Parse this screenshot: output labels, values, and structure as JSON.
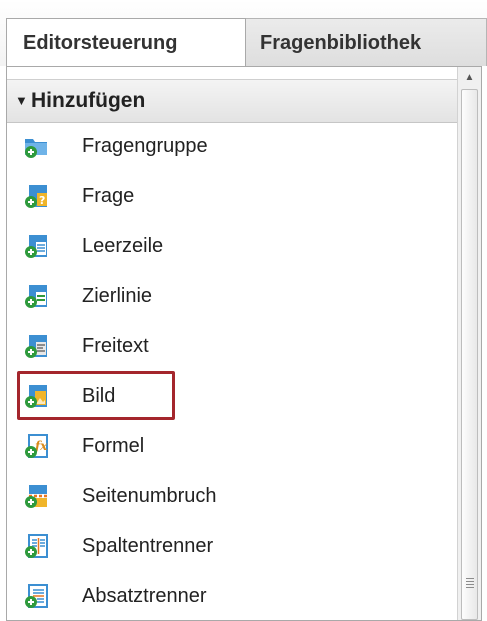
{
  "tabs": [
    {
      "label": "Editorsteuerung",
      "active": true
    },
    {
      "label": "Fragenbibliothek",
      "active": false
    }
  ],
  "section": {
    "title": "Hinzufügen",
    "expanded": true,
    "caret_icon": "caret-down-icon"
  },
  "items": [
    {
      "label": "Fragengruppe",
      "icon": "folder-add-icon"
    },
    {
      "label": "Frage",
      "icon": "question-add-icon"
    },
    {
      "label": "Leerzeile",
      "icon": "blank-line-add-icon"
    },
    {
      "label": "Zierlinie",
      "icon": "decorative-line-add-icon"
    },
    {
      "label": "Freitext",
      "icon": "free-text-add-icon"
    },
    {
      "label": "Bild",
      "icon": "image-add-icon",
      "highlighted": true
    },
    {
      "label": "Formel",
      "icon": "formula-add-icon"
    },
    {
      "label": "Seitenumbruch",
      "icon": "page-break-add-icon"
    },
    {
      "label": "Spaltentrenner",
      "icon": "column-separator-add-icon"
    },
    {
      "label": "Absatztrenner",
      "icon": "paragraph-separator-add-icon"
    }
  ],
  "colors": {
    "highlight_border": "#a4262c",
    "plus_badge": "#2e9a3c",
    "icon_blue": "#3c8fd2",
    "icon_yellow": "#f0b52a"
  }
}
